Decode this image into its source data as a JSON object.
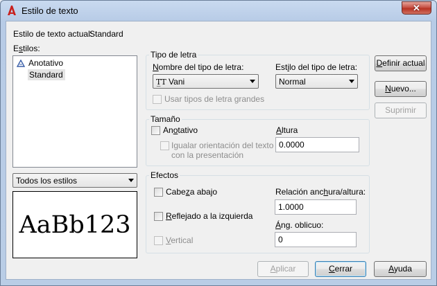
{
  "window": {
    "title": "Estilo de texto",
    "close_glyph": "✕"
  },
  "current_style": {
    "label": "Estilo de texto actual:",
    "value": "Standard"
  },
  "styles": {
    "label": "Estilos:",
    "items": [
      {
        "label": "Anotativo",
        "icon": "annotative-icon"
      },
      {
        "label": "Standard",
        "selected": true
      }
    ],
    "filter_value": "Todos los estilos"
  },
  "preview_text": "AaBb123",
  "font_group": {
    "title": "Tipo de letra",
    "font_name_label": "Nombre del tipo de letra:",
    "font_name_value": "Vani",
    "font_style_label": "Estilo del tipo de letra:",
    "font_style_value": "Normal",
    "use_big_font_label": "Usar tipos de letra grandes"
  },
  "size_group": {
    "title": "Tamaño",
    "annotative_label": "Anotativo",
    "match_orientation_line1": "Igualar orientación del texto",
    "match_orientation_line2": "con la presentación",
    "height_label": "Altura",
    "height_value": "0.0000"
  },
  "effects_group": {
    "title": "Efectos",
    "upside_down_label": "Cabeza abajo",
    "backwards_label": "Reflejado a la izquierda",
    "vertical_label": "Vertical",
    "width_factor_label": "Relación anchura/altura:",
    "width_factor_value": "1.0000",
    "oblique_label": "Áng. oblicuo:",
    "oblique_value": "0"
  },
  "buttons": {
    "set_current": "Definir actual",
    "new": "Nuevo...",
    "delete": "Suprimir",
    "apply": "Aplicar",
    "close": "Cerrar",
    "help": "Ayuda"
  }
}
